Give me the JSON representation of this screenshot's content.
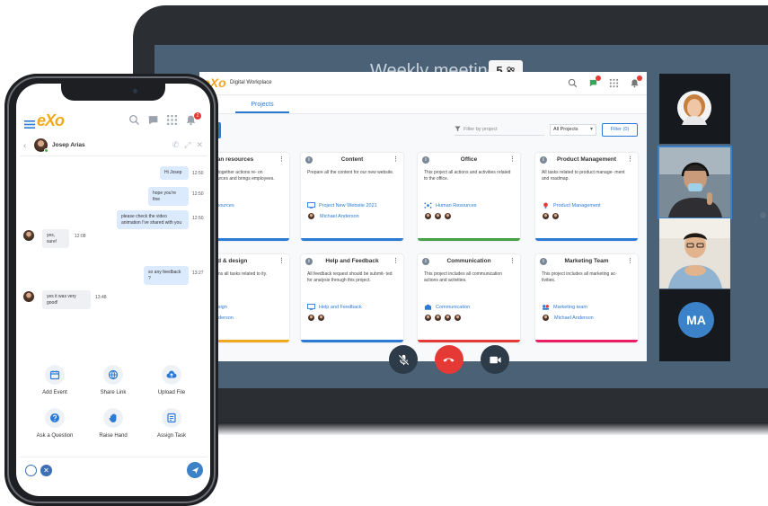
{
  "meeting": {
    "title": "Weekly meeting",
    "participants": "5"
  },
  "desktop": {
    "logo": "eXo",
    "subtitle": "Digital Workplace",
    "tab": "Projects",
    "filter_placeholder": "Filter by project",
    "select_value": "All Projects",
    "filter_button": "Filter (0)"
  },
  "cards": [
    {
      "title": "Human resources",
      "title_visible": "uman resources",
      "desc": "ings together actions re- on resources and brings employees.",
      "link": "n resources",
      "owner": "",
      "bar": "#2b7bd6"
    },
    {
      "title": "Content",
      "desc": "Prepare all the content for our new website.",
      "link": "Project New Website 2021",
      "owner": "Michael Anderson",
      "bar": "#2b7bd6"
    },
    {
      "title": "Office",
      "desc": "This project all actions and activities related to the office.",
      "link": "Human Resources",
      "owner": "",
      "bar": "#43a047"
    },
    {
      "title": "Product Management",
      "desc": "All tasks related to product manage- ment and roadmap.",
      "link": "Product Management",
      "owner": "",
      "bar": "#2b7bd6"
    },
    {
      "title": "Brand & design",
      "title_visible": "rand & design",
      "desc": "ontains all tasks related to ity.",
      "link": "d design",
      "owner": "n Anderson",
      "bar": "#f2a81d"
    },
    {
      "title": "Help and Feedback",
      "desc": "All feedback request should be submit- ted for analysis through this project.",
      "link": "Help and Feedback",
      "owner": "",
      "bar": "#2b7bd6"
    },
    {
      "title": "Communication",
      "desc": "This project includes all communication actions and activities.",
      "link": "Communication",
      "owner": "",
      "bar": "#e53935"
    },
    {
      "title": "Marketing Team",
      "desc": "This project includes all marketing ac- tivities.",
      "link": "Marketing team",
      "owner": "Michael Anderson",
      "bar": "#e91e63"
    }
  ],
  "participants": [
    {
      "initials": "MA"
    }
  ],
  "phone": {
    "logo": "eXo",
    "notifications": "2",
    "contact_name": "Josep Arias",
    "messages": [
      {
        "text": "Hi Josep",
        "time": "12:50",
        "dir": "out"
      },
      {
        "text": "hope you're fine",
        "time": "12:50",
        "dir": "out"
      },
      {
        "text": "please check the video animation I've shared with you",
        "time": "12:50",
        "dir": "out"
      },
      {
        "text": "yes, sure!",
        "time": "12:08",
        "dir": "in"
      },
      {
        "text": "so any feedback ?",
        "time": "13:27",
        "dir": "out"
      },
      {
        "text": "yes it was very good!",
        "time": "13:48",
        "dir": "in"
      }
    ],
    "actions": [
      {
        "label": "Add Event",
        "icon": "calendar-icon"
      },
      {
        "label": "Share Link",
        "icon": "globe-icon"
      },
      {
        "label": "Upload File",
        "icon": "upload-icon"
      },
      {
        "label": "Ask a Question",
        "icon": "question-icon"
      },
      {
        "label": "Raise Hand",
        "icon": "hand-icon"
      },
      {
        "label": "Assign Task",
        "icon": "task-icon"
      }
    ]
  },
  "colors": {
    "brand_orange": "#f2a81d",
    "accent_blue": "#2b7bd6",
    "hangup_red": "#e53935",
    "meeting_bg": "#4b6276"
  }
}
